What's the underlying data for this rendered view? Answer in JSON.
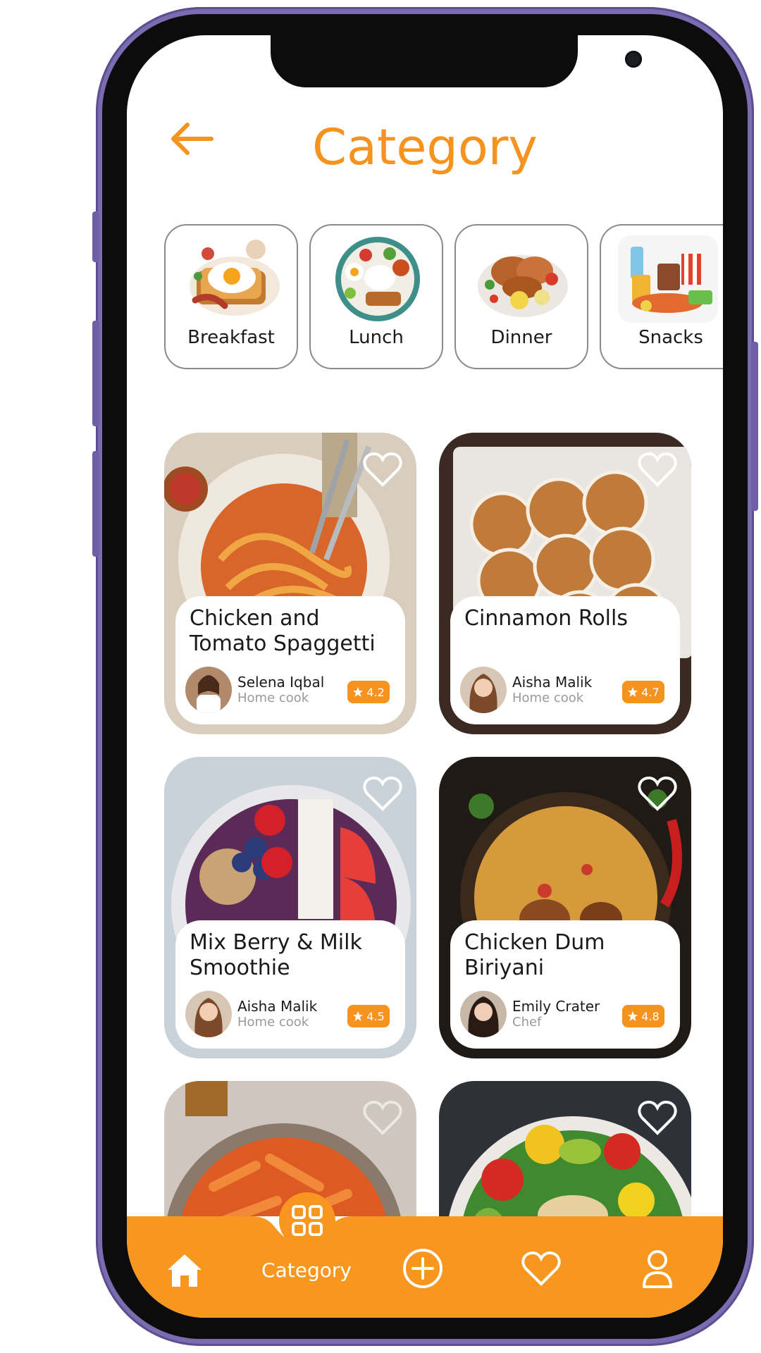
{
  "header": {
    "title": "Category",
    "back_icon": "arrow-left-icon"
  },
  "categories": [
    {
      "label": "Breakfast",
      "icon": "breakfast-plate"
    },
    {
      "label": "Lunch",
      "icon": "lunch-plate"
    },
    {
      "label": "Dinner",
      "icon": "dinner-plate"
    },
    {
      "label": "Snacks",
      "icon": "snacks-pile"
    }
  ],
  "recipes": [
    {
      "title": "Chicken and Tomato Spaggetti",
      "author": "Selena Iqbal",
      "role": "Home cook",
      "rating": "4.2"
    },
    {
      "title": "Cinnamon Rolls",
      "author": "Aisha Malik",
      "role": "Home cook",
      "rating": "4.7"
    },
    {
      "title": "Mix Berry & Milk Smoothie",
      "author": "Aisha Malik",
      "role": "Home cook",
      "rating": "4.5"
    },
    {
      "title": "Chicken Dum Biriyani",
      "author": "Emily Crater",
      "role": "Chef",
      "rating": "4.8"
    },
    {
      "title": "",
      "author": "",
      "role": "",
      "rating": ""
    },
    {
      "title": "",
      "author": "",
      "role": "",
      "rating": ""
    }
  ],
  "bottom_nav": {
    "active_label": "Category",
    "items": [
      "home-icon",
      "category-grid-icon",
      "add-circle-icon",
      "heart-icon",
      "profile-icon"
    ]
  },
  "colors": {
    "accent": "#f5931e",
    "nav_bg": "#f7971f",
    "frame": "#7b6bb0"
  }
}
